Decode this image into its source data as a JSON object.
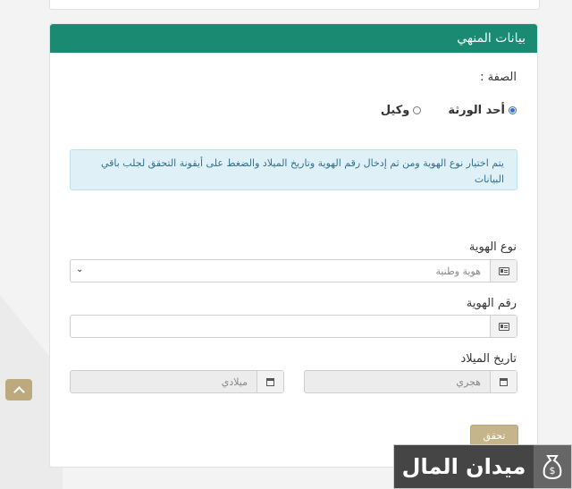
{
  "panel": {
    "title": "بيانات المنهي",
    "capacity_label": "الصفة :",
    "radios": [
      {
        "label": "أحد الورثة",
        "checked": true
      },
      {
        "label": "وكيل",
        "checked": false
      }
    ],
    "info_text": "يتم اختيار نوع الهوية ومن ثم إدخال رقم الهوية وتاريخ الميلاد والضغط على أيقونة التحقق لجلب باقي البيانات",
    "id_type_label": "نوع الهوية",
    "id_type_selected": "هوية وطنية",
    "id_number_label": "رقم الهوية",
    "id_number_value": "",
    "birth_date_label": "تاريخ الميلاد",
    "hijri_placeholder": "هجري",
    "gregorian_placeholder": "ميلادي",
    "verify_label": "تحقق"
  },
  "watermark": {
    "text": "ميدان المال"
  },
  "colors": {
    "header": "#1a8a73",
    "accent": "#c6b48a",
    "info_bg": "#dff0f7"
  },
  "icons": [
    "id-card-icon",
    "calendar-icon",
    "chevron-down-icon",
    "chevron-up-icon"
  ]
}
